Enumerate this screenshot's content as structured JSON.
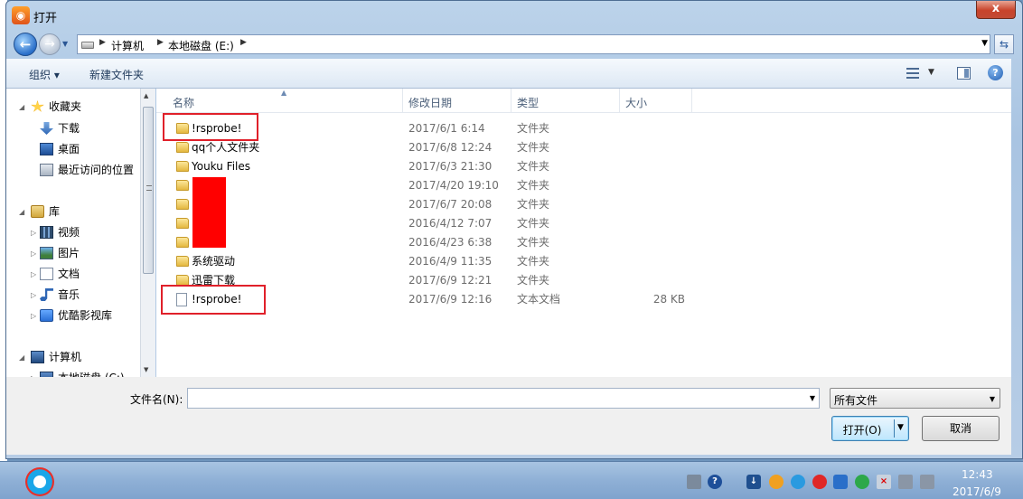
{
  "window": {
    "title": "打开",
    "close_label": "x"
  },
  "address": {
    "segments": [
      "计算机",
      "本地磁盘 (E:)"
    ]
  },
  "toolbar": {
    "organize_label": "组织 ▾",
    "new_folder_label": "新建文件夹"
  },
  "nav": {
    "favorites": {
      "label": "收藏夹",
      "items": [
        "下载",
        "桌面",
        "最近访问的位置"
      ]
    },
    "libraries": {
      "label": "库",
      "items": [
        "视频",
        "图片",
        "文档",
        "音乐",
        "优酷影视库"
      ]
    },
    "computer": {
      "label": "计算机",
      "items": [
        "本地磁盘 (C:)"
      ]
    }
  },
  "columns": {
    "name": "名称",
    "modified": "修改日期",
    "type": "类型",
    "size": "大小"
  },
  "files": [
    {
      "name": "!rsprobe!",
      "date": "2017/6/1 6:14",
      "type": "文件夹",
      "size": "",
      "icon": "folder-icon"
    },
    {
      "name": "qq个人文件夹",
      "date": "2017/6/8 12:24",
      "type": "文件夹",
      "size": "",
      "icon": "folder-icon"
    },
    {
      "name": "Youku Files",
      "date": "2017/6/3 21:30",
      "type": "文件夹",
      "size": "",
      "icon": "folder-icon"
    },
    {
      "name": "",
      "date": "2017/4/20 19:10",
      "type": "文件夹",
      "size": "",
      "icon": "folder-icon"
    },
    {
      "name": "",
      "date": "2017/6/7 20:08",
      "type": "文件夹",
      "size": "",
      "icon": "folder-icon"
    },
    {
      "name": "",
      "date": "2016/4/12 7:07",
      "type": "文件夹",
      "size": "",
      "icon": "folder-icon"
    },
    {
      "name": "",
      "date": "2016/4/23 6:38",
      "type": "文件夹",
      "size": "",
      "icon": "folder-icon"
    },
    {
      "name": "系统驱动",
      "date": "2016/4/9 11:35",
      "type": "文件夹",
      "size": "",
      "icon": "folder-icon"
    },
    {
      "name": "迅雷下载",
      "date": "2017/6/9 12:21",
      "type": "文件夹",
      "size": "",
      "icon": "folder-icon"
    },
    {
      "name": "!rsprobe!",
      "date": "2017/6/9 12:16",
      "type": "文本文档",
      "size": "28 KB",
      "icon": "text-file-icon"
    }
  ],
  "bottom": {
    "filename_label": "文件名(N):",
    "filename_value": "",
    "filetype_value": "所有文件",
    "open_label": "打开(O)",
    "cancel_label": "取消"
  },
  "taskbar": {
    "time": "12:43",
    "date": "2017/6/9"
  },
  "colors": {
    "highlight_box": "#e0202a",
    "redaction": "#ff0000"
  }
}
